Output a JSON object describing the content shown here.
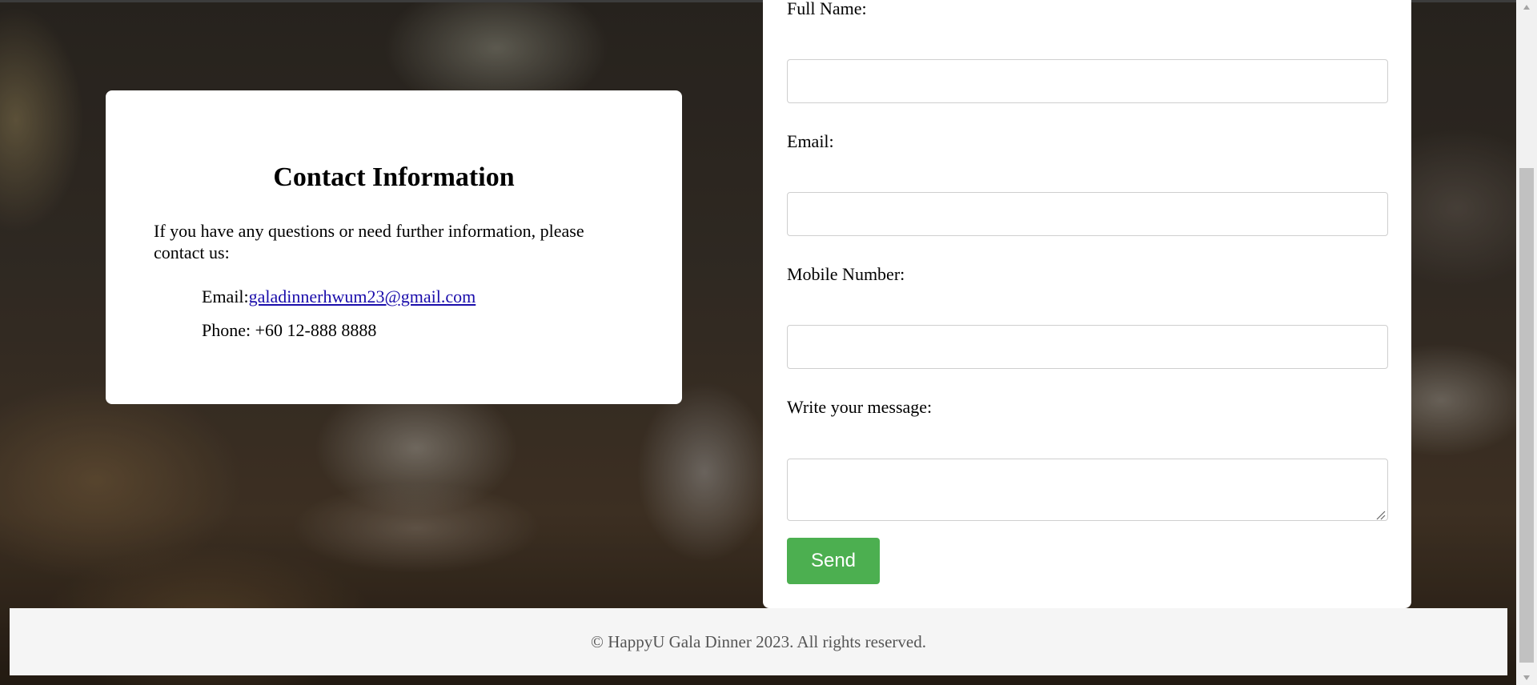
{
  "contact": {
    "title": "Contact Information",
    "intro": "If you have any questions or need further information, please contact us:",
    "email_label": "Email:",
    "email_value": "galadinnerhwum23@gmail.com",
    "phone_text": "Phone: +60 12-888 8888"
  },
  "form": {
    "full_name_label": "Full Name:",
    "full_name_value": "",
    "email_label": "Email:",
    "email_value": "",
    "mobile_label": "Mobile Number:",
    "mobile_value": "",
    "message_label": "Write your message:",
    "message_value": "",
    "send_label": "Send"
  },
  "footer": {
    "text": "© HappyU Gala Dinner 2023. All rights reserved."
  },
  "colors": {
    "send_button": "#4caf50",
    "link": "#1a0dab",
    "footer_bg": "#f5f5f5"
  },
  "icons": {
    "scroll_up": "scroll-up-arrow-icon",
    "scroll_down": "scroll-down-arrow-icon",
    "resize": "resize-grip-icon"
  }
}
